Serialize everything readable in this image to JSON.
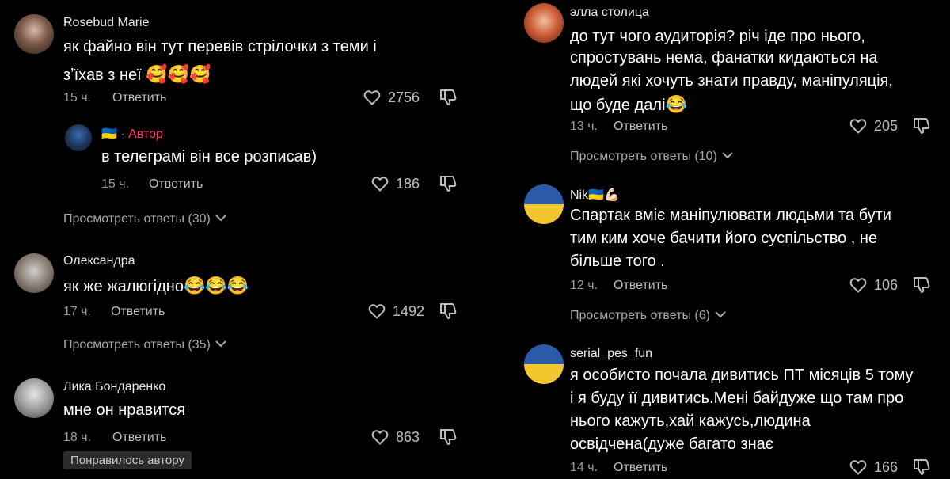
{
  "left": {
    "c1": {
      "author": "Rosebud Marie",
      "line1": "як файно він тут перевів стрілочки з теми і",
      "line2": "зʼїхав з неї",
      "emoji": "🥰🥰🥰",
      "time": "15 ч.",
      "reply": "Ответить",
      "likes": "2756"
    },
    "c1_reply": {
      "flag": "🇺🇦",
      "sep": "·",
      "author_tag": "Автор",
      "text": "в телеграмі він все розписав)",
      "time": "15 ч.",
      "reply": "Ответить",
      "likes": "186"
    },
    "c1_view": "Просмотреть ответы (30)",
    "c2": {
      "author": "Олександра",
      "text": "як же жалюгідно",
      "emoji": "😂😂😂",
      "time": "17 ч.",
      "reply": "Ответить",
      "likes": "1492"
    },
    "c2_view": "Просмотреть ответы (35)",
    "c3": {
      "author": "Лика Бондаренко",
      "text": "мне он нравится",
      "time": "18 ч.",
      "reply": "Ответить",
      "likes": "863",
      "badge": "Понравилось автору"
    }
  },
  "right": {
    "c1": {
      "author": "элла столица",
      "line1": "до тут чого аудиторія? річ іде про нього,",
      "line2": "спростувань нема, фанатки кидаються на",
      "line3": "людей які хочуть знати правду, маніпуляція,",
      "line4": "що буде далі",
      "emoji": "😂",
      "time": "13 ч.",
      "reply": "Ответить",
      "likes": "205"
    },
    "c1_view": "Просмотреть ответы (10)",
    "c2": {
      "author": "Nik",
      "author_emoji": "🇺🇦💪🏻",
      "line1": "Спартак вміє маніпулювати людьми та бути",
      "line2": "тим ким хоче бачити його суспільство , не",
      "line3": "більше того .",
      "time": "12 ч.",
      "reply": "Ответить",
      "likes": "106"
    },
    "c2_view": "Просмотреть ответы (6)",
    "c3": {
      "author": "serial_pes_fun",
      "line1": "я особисто почала дивитись ПТ місяців 5 тому",
      "line2": "і я буду її дивитись.Мені байдуже що там про",
      "line3": "нього кажуть,хай кажусь,людина",
      "line4": "освідчена(дуже багато знає",
      "time": "14 ч.",
      "reply": "Ответить",
      "likes": "166"
    }
  },
  "icons": {
    "heart": "heart-outline-icon",
    "dislike": "thumbs-down-icon",
    "chevron": "chevron-down-icon"
  }
}
